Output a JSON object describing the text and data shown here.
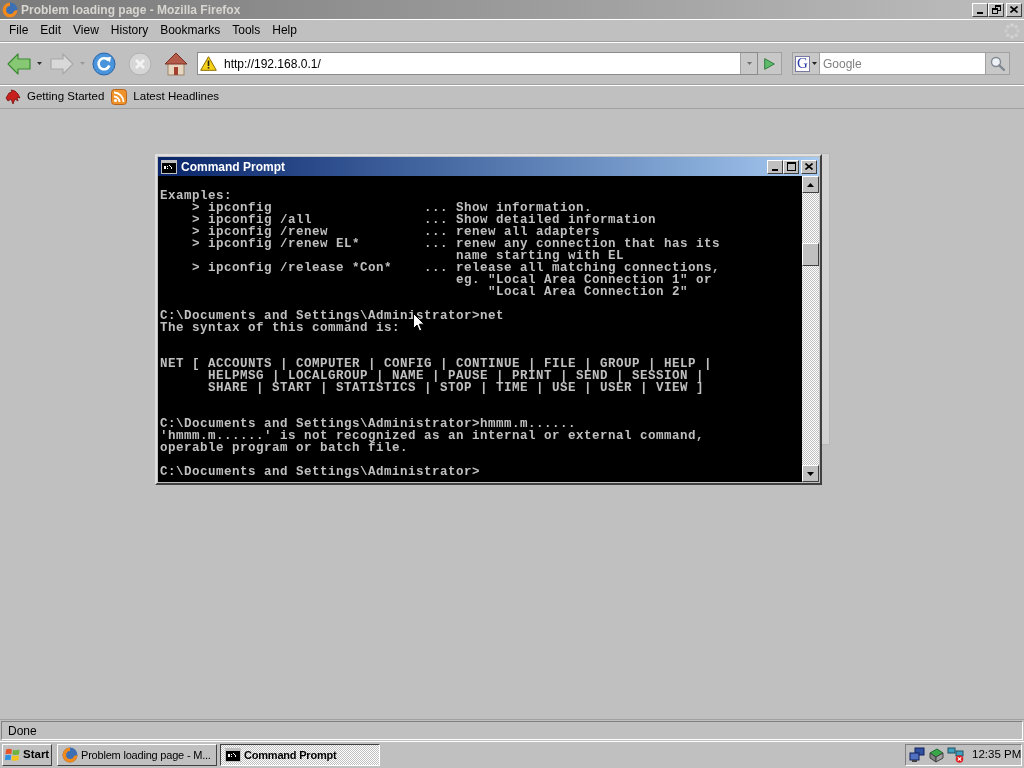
{
  "browser_window": {
    "title": "Problem loading page - Mozilla Firefox",
    "active": false
  },
  "menu_bar": [
    "File",
    "Edit",
    "View",
    "History",
    "Bookmarks",
    "Tools",
    "Help"
  ],
  "navigation_buttons": [
    {
      "kind": "back",
      "disabled": false
    },
    {
      "kind": "forward",
      "disabled": true
    },
    {
      "kind": "reload",
      "disabled": false
    },
    {
      "kind": "stop",
      "disabled": true
    },
    {
      "kind": "home",
      "disabled": false
    }
  ],
  "address_bar": {
    "url": "http://192.168.0.1/"
  },
  "search_bar": {
    "engine": "G",
    "placeholder": "Google"
  },
  "bookmarks_toolbar": [
    {
      "label": "Getting Started",
      "kind": "page"
    },
    {
      "label": "Latest Headlines",
      "kind": "feed"
    }
  ],
  "command_prompt": {
    "title": "Command Prompt",
    "active": true,
    "lines": [
      {
        "kind": "blank"
      },
      {
        "kind": "text",
        "text": "Examples:"
      },
      {
        "kind": "text",
        "text": "    > ipconfig                   ... Show information."
      },
      {
        "kind": "text",
        "text": "    > ipconfig /all              ... Show detailed information"
      },
      {
        "kind": "text",
        "text": "    > ipconfig /renew            ... renew all adapters"
      },
      {
        "kind": "text",
        "text": "    > ipconfig /renew EL*        ... renew any connection that has its"
      },
      {
        "kind": "text",
        "text": "                                     name starting with EL"
      },
      {
        "kind": "text",
        "text": "    > ipconfig /release *Con*    ... release all matching connections,"
      },
      {
        "kind": "text",
        "text": "                                     eg. \"Local Area Connection 1\" or"
      },
      {
        "kind": "text",
        "text": "                                         \"Local Area Connection 2\""
      },
      {
        "kind": "blank"
      },
      {
        "kind": "text",
        "text": "C:\\Documents and Settings\\Administrator>net"
      },
      {
        "kind": "text",
        "text": "The syntax of this command is:"
      },
      {
        "kind": "blank"
      },
      {
        "kind": "blank"
      },
      {
        "kind": "text",
        "text": "NET [ ACCOUNTS | COMPUTER | CONFIG | CONTINUE | FILE | GROUP | HELP |"
      },
      {
        "kind": "text",
        "text": "      HELPMSG | LOCALGROUP | NAME | PAUSE | PRINT | SEND | SESSION |"
      },
      {
        "kind": "text",
        "text": "      SHARE | START | STATISTICS | STOP | TIME | USE | USER | VIEW ]"
      },
      {
        "kind": "blank"
      },
      {
        "kind": "blank"
      },
      {
        "kind": "text",
        "text": "C:\\Documents and Settings\\Administrator>hmmm.m......"
      },
      {
        "kind": "text",
        "text": "'hmmm.m......' is not recognized as an internal or external command,"
      },
      {
        "kind": "text",
        "text": "operable program or batch file."
      },
      {
        "kind": "blank"
      },
      {
        "kind": "text",
        "text": "C:\\Documents and Settings\\Administrator>"
      }
    ]
  },
  "status_bar": {
    "text": "Done"
  },
  "taskbar": {
    "start": "Start",
    "tasks": [
      {
        "label": "Problem loading page - M...",
        "kind": "browser",
        "selected": false
      },
      {
        "label": "Command Prompt",
        "kind": "console",
        "selected": true
      }
    ],
    "clock": "12:35 PM"
  }
}
